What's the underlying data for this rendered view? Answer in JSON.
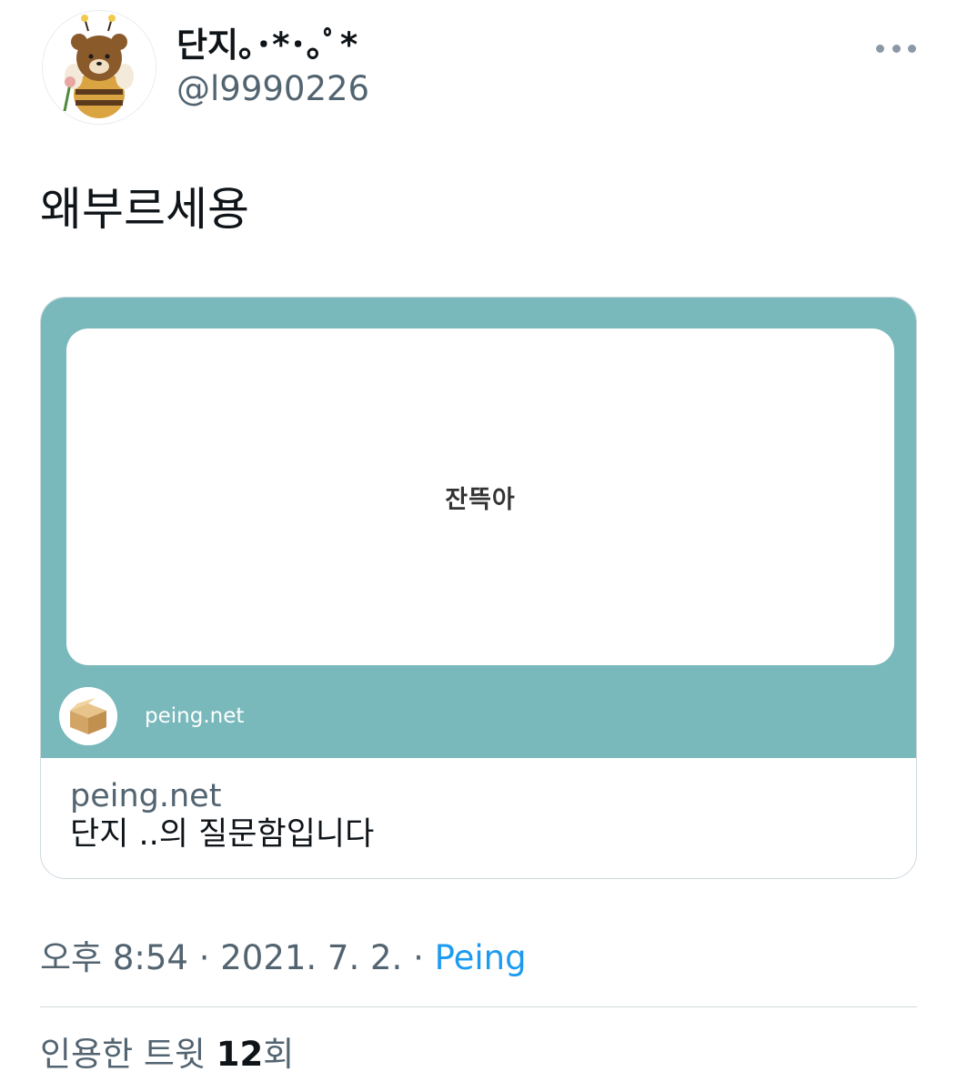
{
  "tweet": {
    "author": {
      "display_name": "단지｡･*･｡ﾟ*",
      "handle": "@l9990226",
      "avatar_icon": "bear-plush-avatar"
    },
    "more_icon": "more-dots-icon",
    "text": "왜부르세용",
    "card": {
      "image": {
        "background_color": "#79b8bb",
        "question": "잔뜩아",
        "brand_label": "peing.net",
        "logo_icon": "cardboard-box-icon"
      },
      "domain": "peing.net",
      "title": "단지 ..의 질문함입니다"
    },
    "timestamp": {
      "time": "오후 8:54",
      "separator": "·",
      "date": "2021. 7. 2.",
      "source": "Peing"
    },
    "quotes": {
      "label": "인용한 트윗",
      "count": "12",
      "suffix": "회"
    }
  }
}
